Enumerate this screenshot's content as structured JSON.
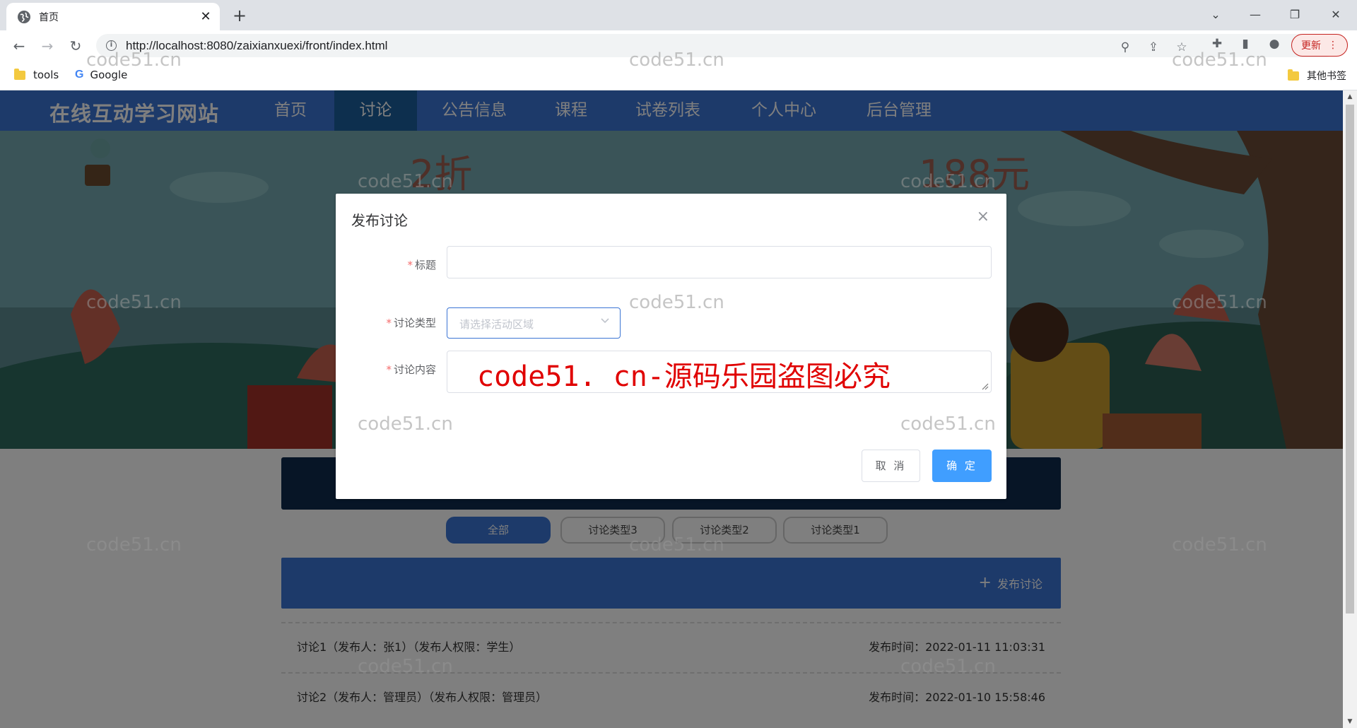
{
  "browser": {
    "tab_title": "首页",
    "url": "http://localhost:8080/zaixianxuexi/front/index.html",
    "update_label": "更新",
    "bookmarks": [
      "tools",
      "Google"
    ],
    "other_bookmarks": "其他书签"
  },
  "site": {
    "brand": "在线互动学习网站",
    "nav": [
      "首页",
      "讨论",
      "公告信息",
      "课程",
      "试卷列表",
      "个人中心",
      "后台管理"
    ],
    "active_nav": "讨论"
  },
  "filters": [
    "全部",
    "讨论类型3",
    "讨论类型2",
    "讨论类型1"
  ],
  "post_button": "发布讨论",
  "posts": [
    {
      "title": "讨论1（发布人：张1）（发布人权限：学生）",
      "time": "发布时间：2022-01-11 11:03:31"
    },
    {
      "title": "讨论2（发布人：管理员）（发布人权限：管理员）",
      "time": "发布时间：2022-01-10 15:58:46"
    }
  ],
  "dialog": {
    "title": "发布讨论",
    "fields": {
      "title_label": "标题",
      "type_label": "讨论类型",
      "type_placeholder": "请选择活动区域",
      "content_label": "讨论内容"
    },
    "cancel": "取 消",
    "ok": "确 定"
  },
  "watermark": "code51.cn",
  "watermark_red": "code51. cn-源码乐园盗图必究",
  "colors": {
    "nav_blue": "#3b74d4",
    "nav_active": "#1b5e9c",
    "primary_button": "#409eff",
    "required_mark": "#f56c6c"
  }
}
